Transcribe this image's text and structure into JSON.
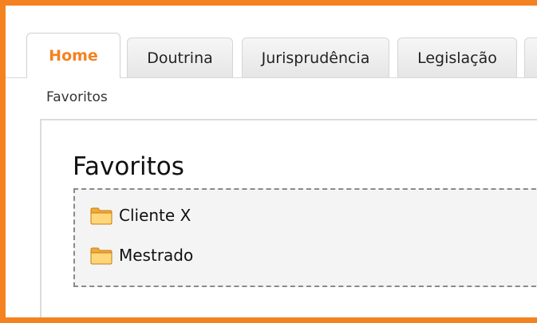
{
  "tabs": [
    {
      "label": "Home",
      "active": true
    },
    {
      "label": "Doutrina",
      "active": false
    },
    {
      "label": "Jurisprudência",
      "active": false
    },
    {
      "label": "Legislação",
      "active": false
    }
  ],
  "breadcrumb": "Favoritos",
  "panel": {
    "title": "Favoritos",
    "folders": [
      {
        "label": "Cliente X",
        "icon": "folder-icon"
      },
      {
        "label": "Mestrado",
        "icon": "folder-icon"
      }
    ]
  },
  "colors": {
    "accent": "#f58220",
    "tab_inactive": "#eeeeee"
  }
}
